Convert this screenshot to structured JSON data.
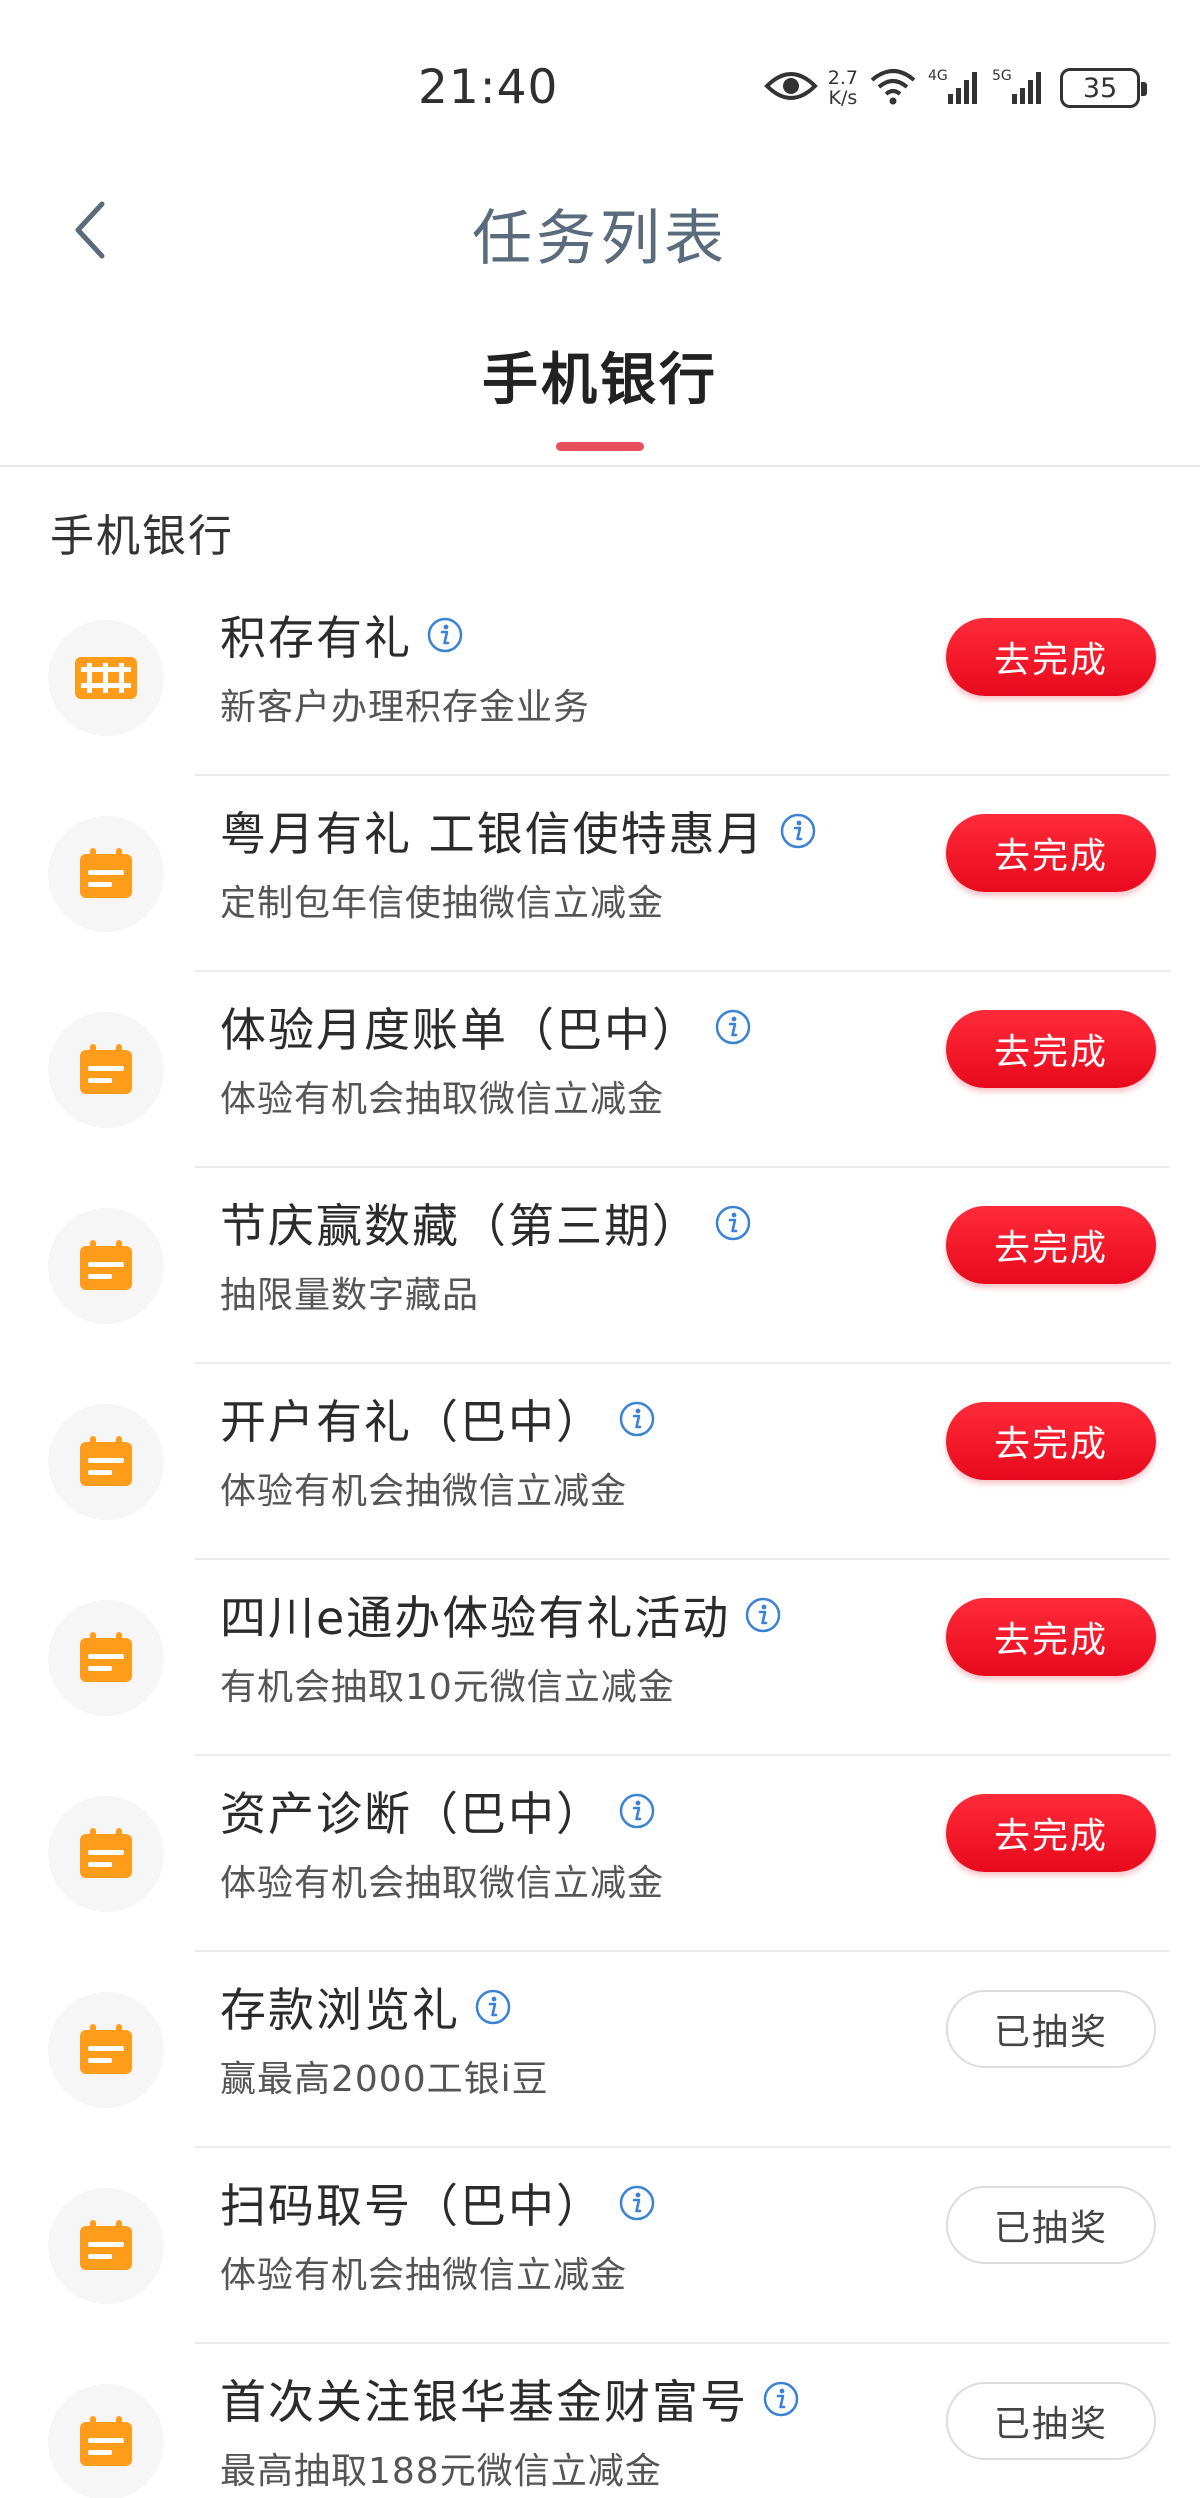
{
  "status_bar": {
    "time": "21:40",
    "net_speed_value": "2.7",
    "net_speed_unit": "K/s",
    "battery": "35",
    "icons": [
      "eye-icon",
      "wifi-icon",
      "signal-4g-icon",
      "signal-5g-icon",
      "battery-icon"
    ]
  },
  "nav": {
    "title": "任务列表",
    "back_icon": "chevron-left-icon"
  },
  "tabs": [
    {
      "label": "手机银行",
      "active": true
    }
  ],
  "colors": {
    "accent_red": "#e8091d",
    "tab_indicator": "#e8505b",
    "icon_orange": "#ff9c1a",
    "info_blue": "#3b82d6"
  },
  "section": {
    "title": "手机银行"
  },
  "tasks": [
    {
      "title": "积存有礼",
      "desc": "新客户办理积存金业务",
      "button": "去完成",
      "state": "active",
      "icon": "gold-bars-icon"
    },
    {
      "title": "粤月有礼 工银信使特惠月",
      "desc": "定制包年信使抽微信立减金",
      "button": "去完成",
      "state": "active",
      "icon": "calendar-icon"
    },
    {
      "title": "体验月度账单（巴中）",
      "desc": "体验有机会抽取微信立减金",
      "button": "去完成",
      "state": "active",
      "icon": "calendar-icon"
    },
    {
      "title": "节庆赢数藏（第三期）",
      "desc": "抽限量数字藏品",
      "button": "去完成",
      "state": "active",
      "icon": "calendar-icon"
    },
    {
      "title": "开户有礼（巴中）",
      "desc": "体验有机会抽微信立减金",
      "button": "去完成",
      "state": "active",
      "icon": "calendar-icon"
    },
    {
      "title": "四川e通办体验有礼活动",
      "desc": "有机会抽取10元微信立减金",
      "button": "去完成",
      "state": "active",
      "icon": "calendar-icon"
    },
    {
      "title": "资产诊断（巴中）",
      "desc": "体验有机会抽取微信立减金",
      "button": "去完成",
      "state": "active",
      "icon": "calendar-icon"
    },
    {
      "title": "存款浏览礼",
      "desc": "赢最高2000工银i豆",
      "button": "已抽奖",
      "state": "done",
      "icon": "calendar-icon"
    },
    {
      "title": "扫码取号（巴中）",
      "desc": "体验有机会抽微信立减金",
      "button": "已抽奖",
      "state": "done",
      "icon": "calendar-icon"
    },
    {
      "title": "首次关注银华基金财富号",
      "desc": "最高抽取188元微信立减金",
      "button": "已抽奖",
      "state": "done",
      "icon": "calendar-icon"
    }
  ]
}
